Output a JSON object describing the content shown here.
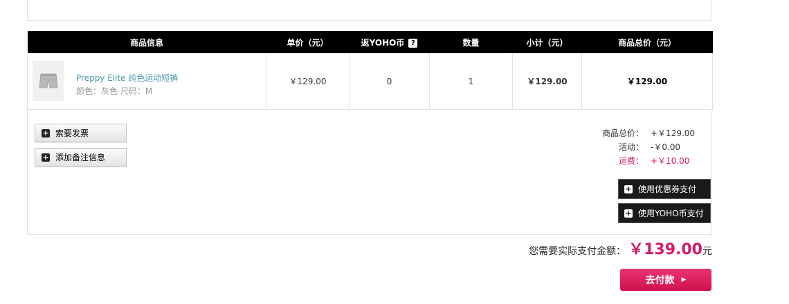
{
  "table": {
    "headers": {
      "product": "商品信息",
      "unit_price": "单价（元）",
      "yoho_return": "返YOHO币",
      "quantity": "数量",
      "subtotal": "小计（元）",
      "total": "商品总价（元）"
    },
    "rows": [
      {
        "name": "Preppy Elite 纯色运动短裤",
        "attrs": "颜色：灰色  尺码：M",
        "unit_price": "￥129.00",
        "yoho_coins": "0",
        "quantity": "1",
        "subtotal": "￥129.00",
        "total": "￥129.00",
        "thumb_icon": "shorts-thumbnail"
      }
    ]
  },
  "actions": {
    "invoice_label": "索要发票",
    "remark_label": "添加备注信息",
    "coupon_label": "使用优惠券支付",
    "yoho_pay_label": "使用YOHO币支付"
  },
  "summary": {
    "goods_label": "商品总价：",
    "goods_value": "+￥129.00",
    "promo_label": "活动：",
    "promo_value": "-￥0.00",
    "shipping_label": "运费：",
    "shipping_value": "+￥10.00"
  },
  "payment": {
    "label": "您需要实际支付金额：",
    "amount": "￥139.00",
    "unit": "元",
    "button_label": "去付款"
  },
  "colors": {
    "accent": "#d3196b",
    "link": "#4a9aa8",
    "header_bg": "#000000"
  }
}
